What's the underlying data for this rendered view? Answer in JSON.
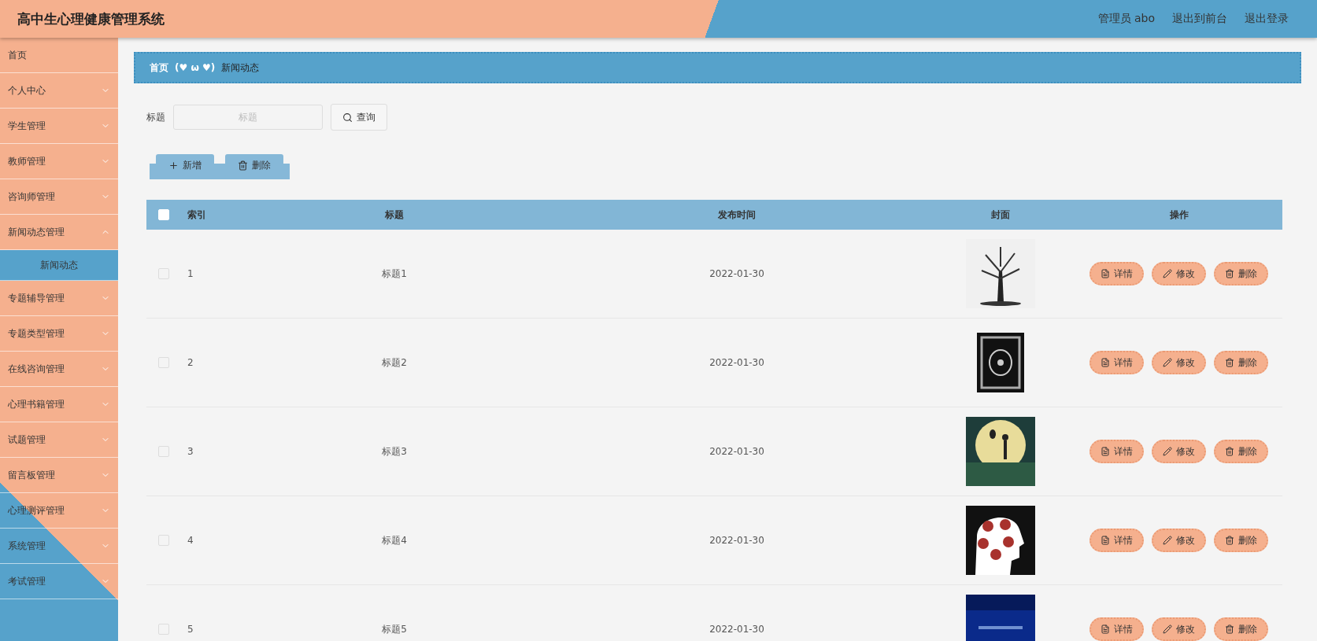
{
  "header": {
    "title": "高中生心理健康管理系统",
    "links": [
      "管理员 abo",
      "退出到前台",
      "退出登录"
    ]
  },
  "sidebar": {
    "items": [
      {
        "label": "首页",
        "kind": "link"
      },
      {
        "label": "个人中心",
        "kind": "menu",
        "expanded": false
      },
      {
        "label": "学生管理",
        "kind": "menu",
        "expanded": false
      },
      {
        "label": "教师管理",
        "kind": "menu",
        "expanded": false
      },
      {
        "label": "咨询师管理",
        "kind": "menu",
        "expanded": false
      },
      {
        "label": "新闻动态管理",
        "kind": "menu",
        "expanded": true,
        "children": [
          {
            "label": "新闻动态",
            "selected": true
          }
        ]
      },
      {
        "label": "专题辅导管理",
        "kind": "menu",
        "expanded": false
      },
      {
        "label": "专题类型管理",
        "kind": "menu",
        "expanded": false
      },
      {
        "label": "在线咨询管理",
        "kind": "menu",
        "expanded": false
      },
      {
        "label": "心理书籍管理",
        "kind": "menu",
        "expanded": false
      },
      {
        "label": "试题管理",
        "kind": "menu",
        "expanded": false
      },
      {
        "label": "留言板管理",
        "kind": "menu",
        "expanded": false
      },
      {
        "label": "心理测评管理",
        "kind": "menu",
        "expanded": false
      },
      {
        "label": "系统管理",
        "kind": "menu",
        "expanded": false
      },
      {
        "label": "考试管理",
        "kind": "menu",
        "expanded": false
      }
    ]
  },
  "breadcrumb": {
    "items": [
      "首页",
      "新闻动态"
    ],
    "separator": "(♥ ω ♥)"
  },
  "search": {
    "label": "标题",
    "placeholder": "标题",
    "button": "查询"
  },
  "actions": [
    "新增",
    "删除"
  ],
  "table": {
    "columns": [
      "索引",
      "标题",
      "发布时间",
      "封面",
      "操作"
    ],
    "all_checked": false,
    "rows": [
      {
        "checked": false,
        "index": "1",
        "title": "标题1",
        "date": "2022-01-30",
        "buttons": [
          "详情",
          "修改",
          "删除"
        ]
      },
      {
        "checked": false,
        "index": "2",
        "title": "标题2",
        "date": "2022-01-30",
        "buttons": [
          "详情",
          "修改",
          "删除"
        ]
      },
      {
        "checked": false,
        "index": "3",
        "title": "标题3",
        "date": "2022-01-30",
        "buttons": [
          "详情",
          "修改",
          "删除"
        ]
      },
      {
        "checked": false,
        "index": "4",
        "title": "标题4",
        "date": "2022-01-30",
        "buttons": [
          "详情",
          "修改",
          "删除"
        ]
      },
      {
        "checked": false,
        "index": "5",
        "title": "标题5",
        "date": "2022-01-30",
        "buttons": [
          "详情",
          "修改",
          "删除"
        ]
      }
    ]
  }
}
